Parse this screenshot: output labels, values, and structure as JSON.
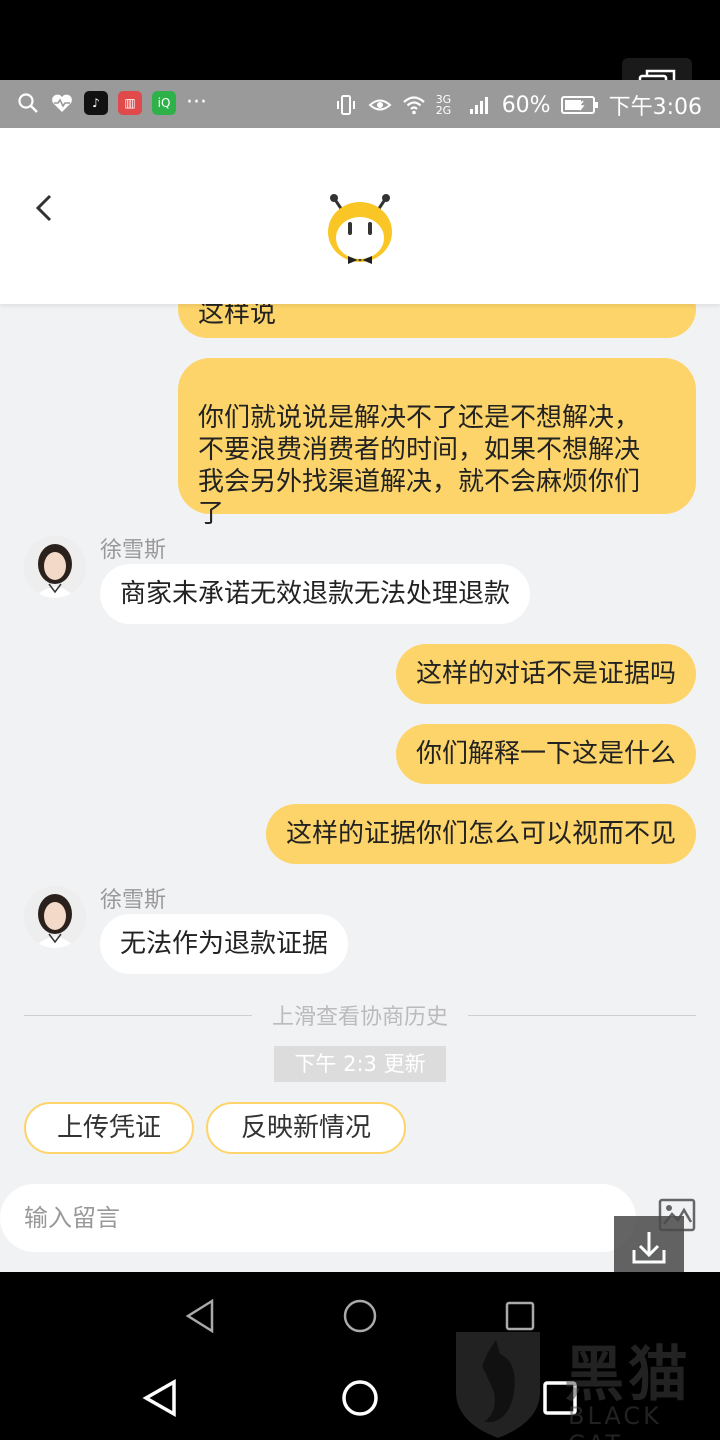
{
  "status_bar": {
    "battery": "60%",
    "time": "下午3:06",
    "network": "3G 2G"
  },
  "header": {
    "logo_name": "mascot-logo"
  },
  "messages": [
    {
      "from": "me",
      "text": "这样说"
    },
    {
      "from": "me",
      "text": "你们就说说是解决不了还是不想解决，\n不要浪费消费者的时间，如果不想解决\n我会另外找渠道解决，就不会麻烦你们\n了"
    },
    {
      "from": "agent",
      "sender": "徐雪斯",
      "text": "商家未承诺无效退款无法处理退款"
    },
    {
      "from": "me",
      "text": "这样的对话不是证据吗"
    },
    {
      "from": "me",
      "text": "你们解释一下这是什么"
    },
    {
      "from": "me",
      "text": "这样的证据你们怎么可以视而不见"
    },
    {
      "from": "agent",
      "sender": "徐雪斯",
      "text": "无法作为退款证据"
    }
  ],
  "history_divider": "上滑查看协商历史",
  "update_chip": "下午 2:3 更新",
  "actions": {
    "upload": "上传凭证",
    "report": "反映新情况"
  },
  "input": {
    "placeholder": "输入留言"
  },
  "watermark": {
    "text": "黑猫",
    "sub": "BLACK CAT"
  },
  "colors": {
    "bubble_me": "#fcd469",
    "bubble_agent": "#ffffff",
    "chat_bg": "#f1f2f4",
    "accent": "#fcd469"
  }
}
